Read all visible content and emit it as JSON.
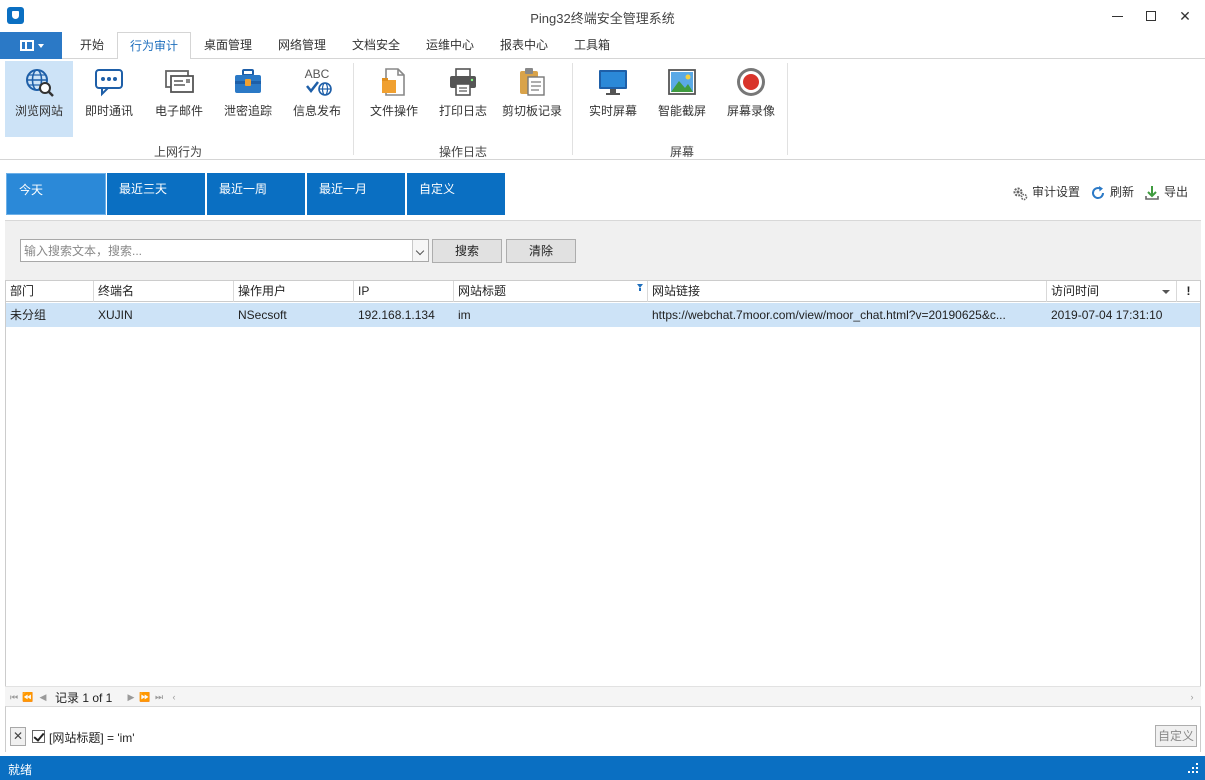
{
  "window": {
    "title": "Ping32终端安全管理系统",
    "minimize_glyph": "",
    "close_glyph": "✕"
  },
  "tabs": [
    "开始",
    "行为审计",
    "桌面管理",
    "网络管理",
    "文档安全",
    "运维中心",
    "报表中心",
    "工具箱"
  ],
  "active_tab": "行为审计",
  "ribbon": {
    "groups": [
      {
        "label": "上网行为",
        "buttons": [
          "浏览网站",
          "即时通讯",
          "电子邮件",
          "泄密追踪",
          "信息发布"
        ]
      },
      {
        "label": "操作日志",
        "buttons": [
          "文件操作",
          "打印日志",
          "剪切板记录"
        ]
      },
      {
        "label": "屏幕",
        "buttons": [
          "实时屏幕",
          "智能截屏",
          "屏幕录像"
        ]
      }
    ],
    "selected_button": "浏览网站",
    "abc_text": "ABC"
  },
  "date_filters": [
    "今天",
    "最近三天",
    "最近一周",
    "最近一月",
    "自定义"
  ],
  "active_date_filter": "今天",
  "toolbar": {
    "audit_settings": "审计设置",
    "refresh": "刷新",
    "export": "导出"
  },
  "search": {
    "placeholder": "输入搜索文本，搜索...",
    "value": "",
    "search_button": "搜索",
    "clear_button": "清除"
  },
  "grid": {
    "columns": [
      "部门",
      "终端名",
      "操作用户",
      "IP",
      "网站标题",
      "网站链接",
      "访问时间",
      "!"
    ],
    "rows": [
      [
        "未分组",
        "XUJIN",
        "NSecsoft",
        "192.168.1.134",
        "im",
        "https://webchat.7moor.com/view/moor_chat.html?v=20190625&c...",
        "2019-07-04 17:31:10"
      ]
    ]
  },
  "pager": {
    "text": "记录 1 of 1"
  },
  "filter_panel": {
    "clear_glyph": "✕",
    "expression": "[网站标题] = 'im'",
    "custom_button": "自定义"
  },
  "status": {
    "text": "就绪"
  },
  "colors": {
    "accent": "#0a6fc2",
    "tile_active": "#2b89d8",
    "selection": "#cde3f7"
  }
}
